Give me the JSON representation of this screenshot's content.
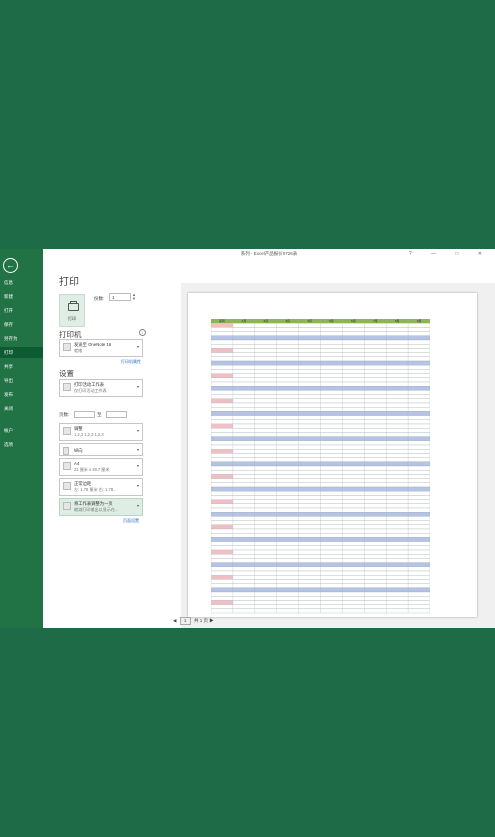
{
  "window": {
    "title": "系列 - Excel产品报价0726表",
    "controls": [
      "?",
      "—",
      "□",
      "✕"
    ]
  },
  "sidebar": {
    "back_icon": "arrow-left-icon",
    "items": [
      {
        "label": "信息",
        "active": false
      },
      {
        "label": "新建",
        "active": false
      },
      {
        "label": "打开",
        "active": false
      },
      {
        "label": "保存",
        "active": false
      },
      {
        "label": "另存为",
        "active": false
      },
      {
        "label": "打印",
        "active": true
      },
      {
        "label": "共享",
        "active": false
      },
      {
        "label": "导出",
        "active": false
      },
      {
        "label": "发布",
        "active": false
      },
      {
        "label": "关闭",
        "active": false
      },
      {
        "label": "帐户",
        "active": false
      },
      {
        "label": "选项",
        "active": false
      }
    ]
  },
  "print": {
    "heading": "打印",
    "print_button_label": "打印",
    "copies_label": "份数:",
    "copies_value": "1",
    "printer_heading": "打印机",
    "printer_name": "发送至 OneNote 16",
    "printer_status": "就绪",
    "printer_properties_link": "打印机属性",
    "settings_heading": "设置",
    "scope_line1": "打印活动工作表",
    "scope_line2": "仅打印活动工作表",
    "pages_label": "页数:",
    "pages_to_label": "至",
    "collate_line1": "调整",
    "collate_line2": "1,2,3  1,2,3  1,2,3",
    "orientation": "纵向",
    "paper_line1": "A4",
    "paper_line2": "21 厘米 x 29.7 厘米",
    "margins_line1": "正常边距",
    "margins_line2": "左: 1.78 厘米  右: 1.78...",
    "scaling_line1": "将工作表调整为一页",
    "scaling_line2": "缩减打印输出以显示在...",
    "page_setup_link": "页面设置"
  },
  "preview": {
    "current_page": "1",
    "total_pages": "共 1 页",
    "sheet_headers": [
      "系列",
      "1月",
      "2月",
      "3月",
      "4月",
      "5月",
      "6月",
      "7月",
      "8月",
      "9月"
    ],
    "group_labels": [
      "产品一 营销",
      "产品二 渠道",
      "产品三 直营",
      "产品四 代理"
    ],
    "colors": {
      "header_green": "#8db35b",
      "group_blue": "#b4c3e6",
      "row_white": "#ffffff",
      "label_pink": "#f0bfc6",
      "ribbon_green": "#217346"
    }
  }
}
